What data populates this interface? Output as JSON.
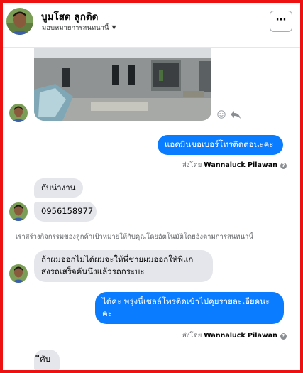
{
  "header": {
    "name": "บูมโสด ลูกติด",
    "subtitle": "มอบหมายการสนทนานี้",
    "more_label": "···"
  },
  "messages": [
    {
      "id": "m1",
      "direction": "out",
      "text": "แอดมินขอเบอร์โทรติดต่อนะคะ"
    },
    {
      "id": "m2",
      "direction": "in",
      "text": "กับน่างาน"
    },
    {
      "id": "m3",
      "direction": "in",
      "text": "0956158977"
    },
    {
      "id": "m4",
      "direction": "in",
      "lines": [
        "ถ้าผมออกไม่ได้ผมจะให้พี่ชายผมออกให้พี่แก",
        "ส่งรถเสร็จค้นนึงแล้วรถกระบะ"
      ]
    },
    {
      "id": "m5",
      "direction": "out",
      "lines": [
        "ได้ค่ะ พรุ่งนี้เซลล์โทรติดเข้าไปคุยรายละเอียดนะ",
        "คะ"
      ]
    },
    {
      "id": "m6",
      "direction": "in",
      "text": "ีคับ"
    }
  ],
  "sent_by": {
    "prefix": "ส่งโดย",
    "agent": "Wannaluck Pilawan",
    "info_glyph": "?"
  },
  "system_note": "เราสร้างกิจกรรมของลูกค้าเป้าหมายให้กับคุณโดยอัตโนมัติโดยอิงตามการสนทนานี้",
  "colors": {
    "outgoing_bubble": "#0a7cff",
    "incoming_bubble": "#e4e6eb",
    "frame_border": "#ee1111"
  }
}
